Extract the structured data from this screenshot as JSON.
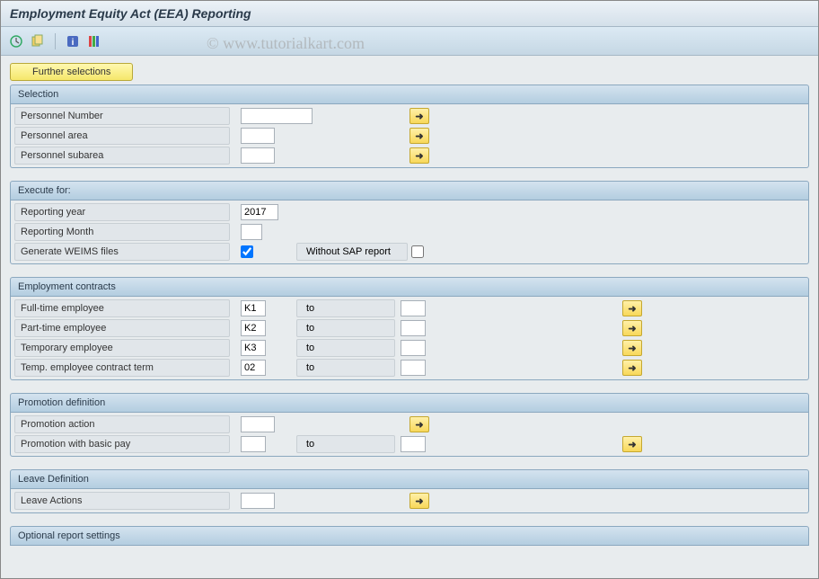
{
  "title": "Employment Equity Act (EEA) Reporting",
  "watermark": "© www.tutorialkart.com",
  "buttons": {
    "further_selections": "Further selections"
  },
  "selection": {
    "header": "Selection",
    "rows": {
      "personnel_number": {
        "label": "Personnel Number",
        "value": ""
      },
      "personnel_area": {
        "label": "Personnel area",
        "value": ""
      },
      "personnel_subarea": {
        "label": "Personnel subarea",
        "value": ""
      }
    }
  },
  "execute": {
    "header": "Execute for:",
    "reporting_year": {
      "label": "Reporting year",
      "value": "2017"
    },
    "reporting_month": {
      "label": "Reporting Month",
      "value": ""
    },
    "generate_weims": {
      "label": "Generate WEIMS files",
      "checked": true
    },
    "without_sap": {
      "label": "Without SAP report",
      "checked": false
    }
  },
  "contracts": {
    "header": "Employment contracts",
    "to_label": "to",
    "rows": {
      "fulltime": {
        "label": "Full-time employee",
        "from": "K1",
        "to": ""
      },
      "parttime": {
        "label": "Part-time employee",
        "from": "K2",
        "to": ""
      },
      "temporary": {
        "label": "Temporary employee",
        "from": "K3",
        "to": ""
      },
      "temp_term": {
        "label": "Temp. employee contract term",
        "from": "02",
        "to": ""
      }
    }
  },
  "promotion": {
    "header": "Promotion definition",
    "to_label": "to",
    "action": {
      "label": "Promotion action",
      "value": ""
    },
    "basicpay": {
      "label": "Promotion with basic pay",
      "from": "",
      "to": ""
    }
  },
  "leave": {
    "header": "Leave Definition",
    "actions": {
      "label": "Leave Actions",
      "value": ""
    }
  },
  "optional": {
    "header": "Optional report settings"
  }
}
